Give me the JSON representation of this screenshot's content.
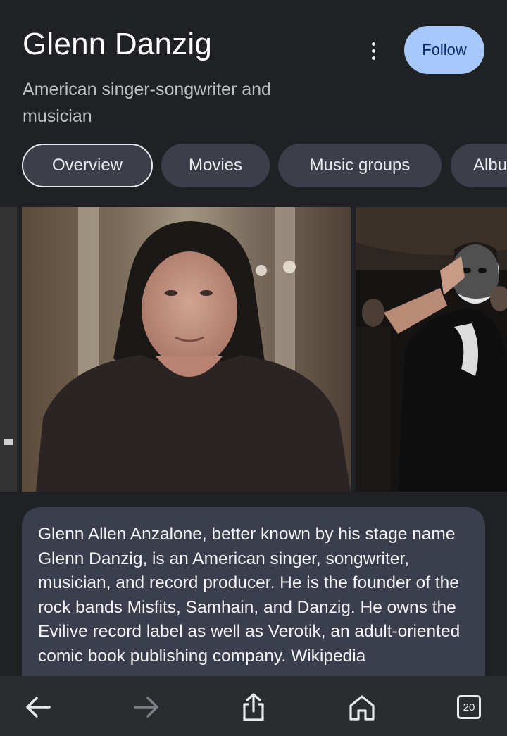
{
  "header": {
    "title": "Glenn Danzig",
    "subtitle": "American singer-songwriter and musician",
    "more_icon": "more-vert-icon",
    "follow_label": "Follow"
  },
  "tabs": [
    {
      "label": "Overview",
      "active": true
    },
    {
      "label": "Movies",
      "active": false
    },
    {
      "label": "Music groups",
      "active": false
    },
    {
      "label": "Albu",
      "active": false
    }
  ],
  "description": "Glenn Allen Anzalone, better known by his stage name Glenn Danzig, is an American singer, songwriter, musician, and record producer. He is the founder of the rock bands Misfits, Samhain, and Danzig. He owns the Evilive record label as well as Verotik, an adult-oriented comic book publishing company. Wikipedia",
  "bottom_nav": {
    "back_icon": "back-arrow-icon",
    "forward_icon": "forward-arrow-icon",
    "share_icon": "share-icon",
    "home_icon": "home-icon",
    "tabs_count": "20"
  },
  "colors": {
    "background": "#202124",
    "follow_button": "#a8c7fa",
    "chip": "#3c3f4a",
    "card": "#3b3e4d"
  }
}
